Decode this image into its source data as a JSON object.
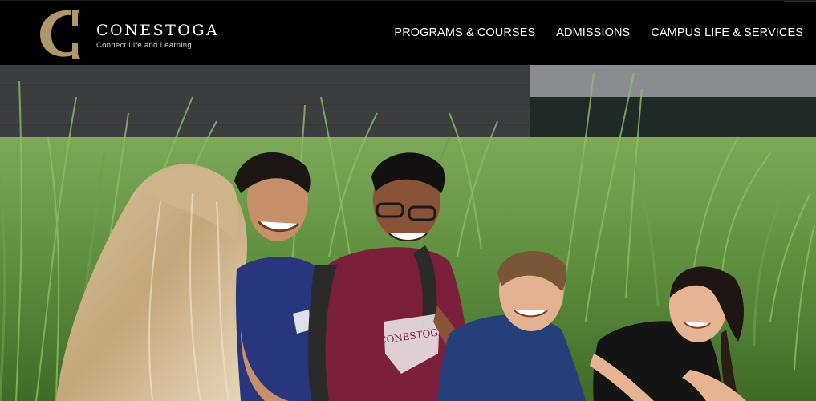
{
  "header": {
    "brand": {
      "name": "CONESTOGA",
      "tagline": "Connect Life and Learning",
      "logo_icon": "conestoga-c-logo",
      "logo_color": "#B0946A"
    },
    "nav": [
      {
        "label": "PROGRAMS & COURSES"
      },
      {
        "label": "ADMISSIONS"
      },
      {
        "label": "CAMPUS LIFE & SERVICES"
      }
    ]
  },
  "hero": {
    "image": "students-sitting-in-tall-grass",
    "shirt_text": "CONESTOGA"
  }
}
